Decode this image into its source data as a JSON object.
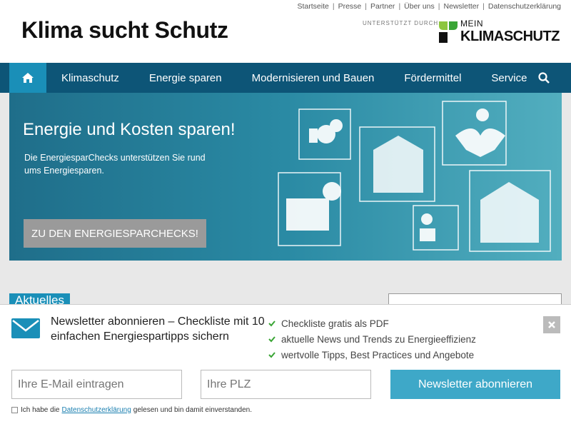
{
  "toplinks": [
    "Startseite",
    "Presse",
    "Partner",
    "Über uns",
    "Newsletter",
    "Datenschutzerklärung"
  ],
  "header": {
    "title": "Klima sucht Schutz",
    "support_label": "UNTERSTÜTZT DURCH:",
    "logo_mein": "MEIN",
    "logo_klima": "KLIMASCHUTZ"
  },
  "nav": {
    "home_icon": "home-icon",
    "items": [
      "Klimaschutz",
      "Energie sparen",
      "Modernisieren und Bauen",
      "Fördermittel",
      "Service"
    ],
    "search_icon": "search-icon"
  },
  "hero": {
    "title": "Energie und Kosten sparen!",
    "text": "Die EnergiesparChecks unterstützen Sie rund ums Energiesparen.",
    "button": "ZU DEN ENERGIESPARCHECKS!"
  },
  "section": {
    "news_tab": "Aktuelles"
  },
  "newsletter": {
    "title": "Newsletter abonnieren – Checkliste mit 10 einfachen Energiespartipps sichern",
    "benefits": [
      "Checkliste gratis als PDF",
      "aktuelle News und Trends zu Energieeffizienz",
      "wertvolle Tipps, Best Practices und Angebote"
    ],
    "email_placeholder": "Ihre E-Mail eintragen",
    "plz_placeholder": "Ihre PLZ",
    "submit": "Newsletter abonnieren",
    "consent_before": "Ich habe die",
    "consent_link": "Datenschutzerklärung",
    "consent_after": "gelesen und bin damit einverstanden.",
    "close_icon": "close-icon"
  },
  "colors": {
    "nav": "#0d5577",
    "accent": "#1a8fb8",
    "button": "#3ea8c8",
    "logo_green": "#8cc63f"
  }
}
